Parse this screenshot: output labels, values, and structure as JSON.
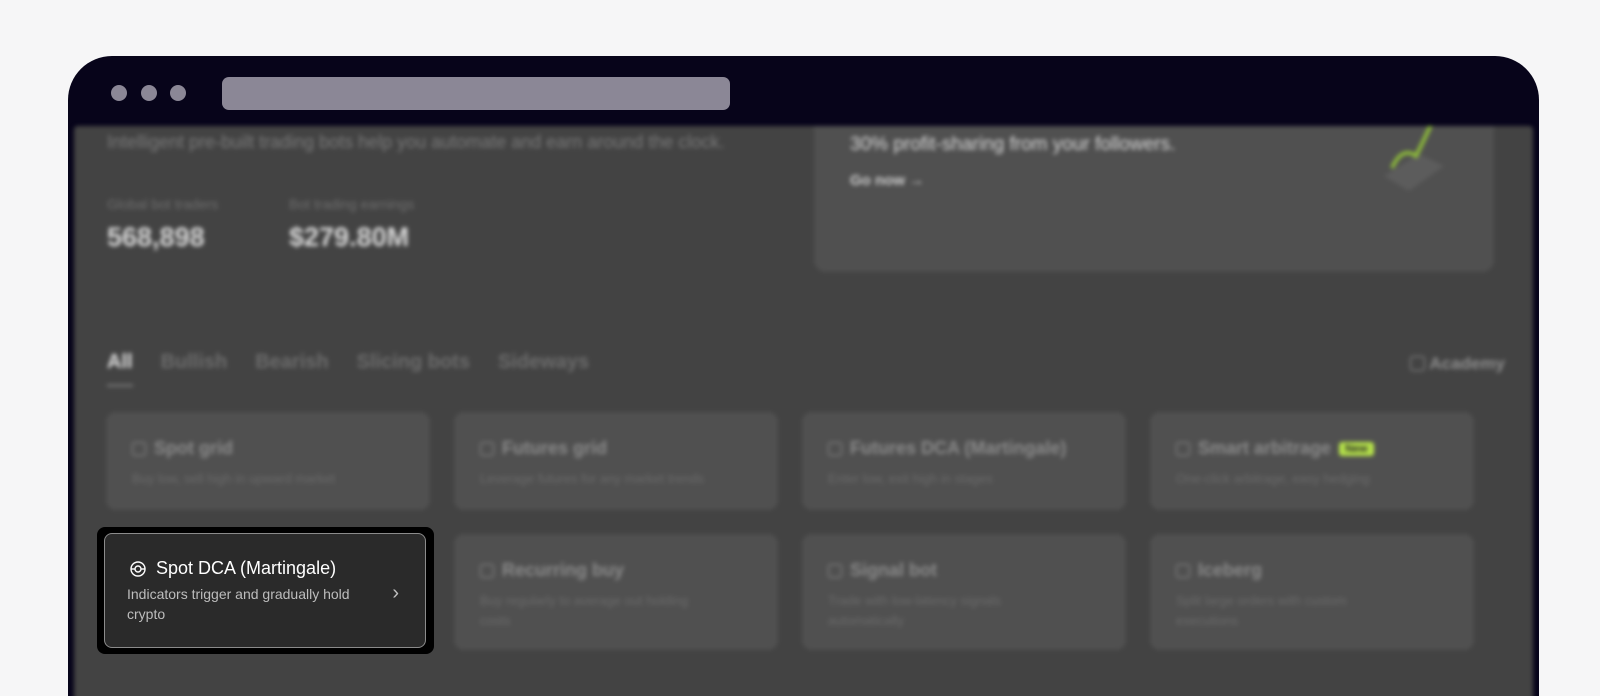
{
  "hero": {
    "subtitle": "Intelligent pre-built trading bots help you automate and earn around the clock.",
    "stats": [
      {
        "label": "Global bot traders",
        "value": "568,898"
      },
      {
        "label": "Bot trading earnings",
        "value": "$279.80M"
      }
    ]
  },
  "banner": {
    "text": "30% profit-sharing from your followers.",
    "link": "Go now →"
  },
  "tabs": [
    "All",
    "Bullish",
    "Bearish",
    "Slicing bots",
    "Sideways"
  ],
  "academy_label": "Academy",
  "cards": [
    {
      "title": "Spot grid",
      "desc": "Buy low, sell high in upward market"
    },
    {
      "title": "Futures grid",
      "desc": "Leverage futures for any market trends"
    },
    {
      "title": "Futures DCA (Martingale)",
      "desc": "Enter low, exit high in stages"
    },
    {
      "title": "Smart arbitrage",
      "badge": "New",
      "desc": "One-click arbitrage, easy hedging"
    },
    {
      "title": "Spot DCA (Martingale)",
      "desc": "Indicators trigger and gradually hold crypto"
    },
    {
      "title": "Recurring buy",
      "desc": "Buy regularly to average out holding costs"
    },
    {
      "title": "Signal bot",
      "desc": "Trade with low-latency signals automatically"
    },
    {
      "title": "Iceberg",
      "desc": "Split large orders with custom executions"
    }
  ],
  "colors": {
    "badge": "#b6e34a",
    "frame": "#07041a"
  }
}
